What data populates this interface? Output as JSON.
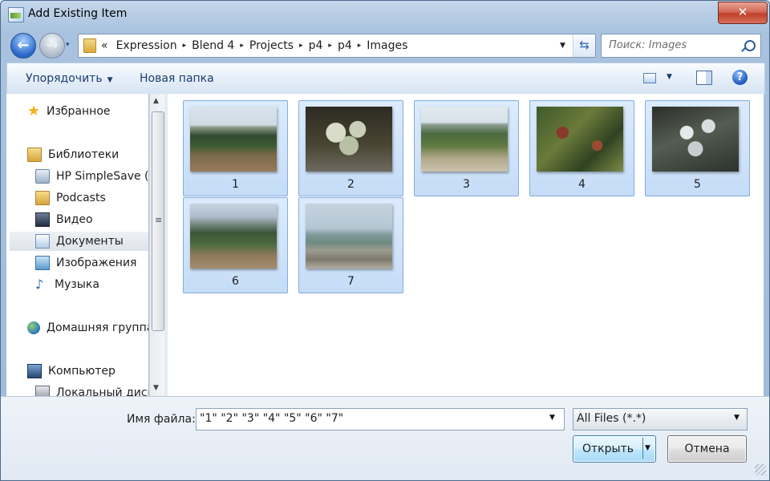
{
  "window": {
    "title": "Add Existing Item",
    "close_label": "✕"
  },
  "nav": {
    "back_glyph": "←",
    "forward_glyph": "→",
    "history_dropdown_glyph": "▾",
    "address": {
      "leading": "«",
      "crumbs": [
        "Expression",
        "Blend 4",
        "Projects",
        "p4",
        "p4",
        "Images"
      ],
      "separator_glyph": "▸",
      "dropdown_glyph": "▼",
      "refresh_glyph": "⇆"
    },
    "search": {
      "placeholder": "Поиск: Images",
      "icon": "search-icon"
    }
  },
  "commandbar": {
    "organize": "Упорядочить",
    "organize_arrow": "▼",
    "new_folder": "Новая папка",
    "views_arrow": "▼",
    "help_glyph": "?"
  },
  "sidebar": {
    "favorites": "Избранное",
    "libraries": "Библиотеки",
    "library_items": [
      "HP SimpleSave (F",
      "Podcasts",
      "Видео",
      "Документы",
      "Изображения",
      "Музыка"
    ],
    "selected": "Документы",
    "homegroup": "Домашняя группа",
    "computer": "Компьютер",
    "computer_items": [
      "Локальный диск"
    ],
    "scroll_up_glyph": "▲",
    "scroll_down_glyph": "▼",
    "scroll_grip_glyph": "≡"
  },
  "files": [
    {
      "name": "1",
      "selected": true
    },
    {
      "name": "2",
      "selected": true
    },
    {
      "name": "3",
      "selected": true
    },
    {
      "name": "4",
      "selected": true
    },
    {
      "name": "5",
      "selected": true
    },
    {
      "name": "6",
      "selected": true
    },
    {
      "name": "7",
      "selected": true
    }
  ],
  "bottom": {
    "filename_label": "Имя файла:",
    "filename_value": "\"1\" \"2\" \"3\" \"4\" \"5\" \"6\" \"7\"",
    "dropdown_glyph": "▼",
    "filter_value": "All Files (*.*)",
    "open_label": "Открыть",
    "cancel_label": "Отмена"
  }
}
